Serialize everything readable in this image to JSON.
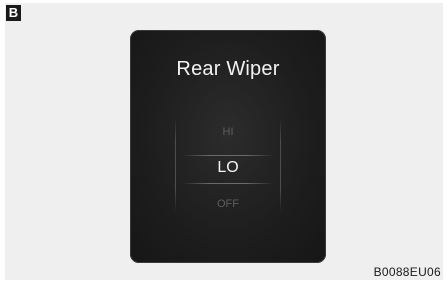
{
  "figure": {
    "badge": "B",
    "code": "B0088EU06"
  },
  "display": {
    "title": "Rear Wiper",
    "options": [
      {
        "label": "HI",
        "selected": false
      },
      {
        "label": "LO",
        "selected": true
      },
      {
        "label": "OFF",
        "selected": false
      }
    ],
    "colors": {
      "panel_background": "#1e1e1e",
      "selected_text": "#f4f4f4",
      "unselected_text": "#5e5e5e",
      "figure_background": "#efefef"
    }
  }
}
